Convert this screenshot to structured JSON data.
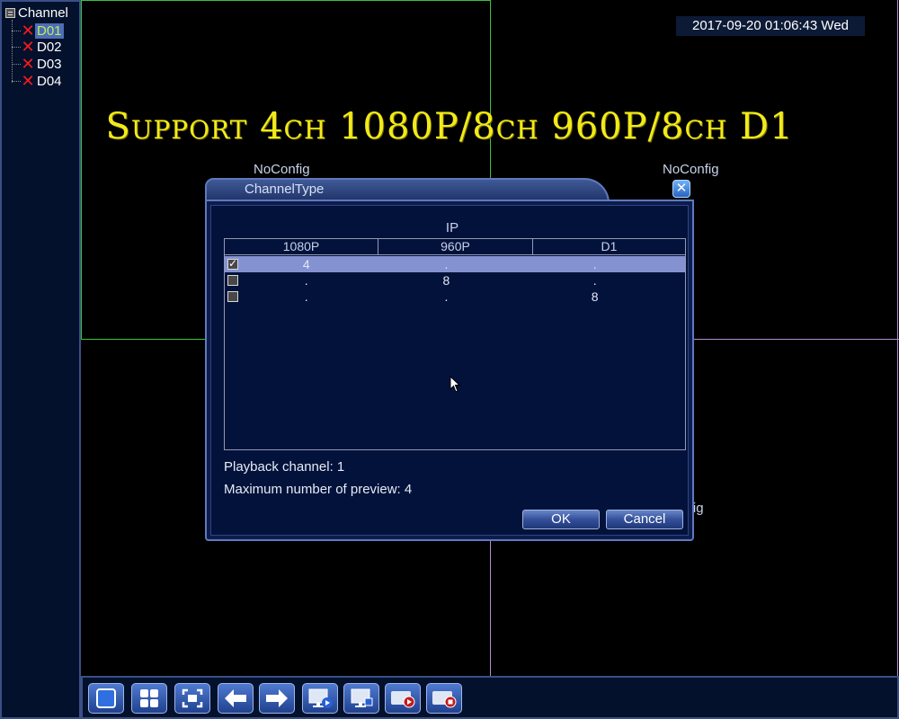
{
  "sidebar": {
    "root_label": "Channel",
    "channels": [
      {
        "label": "D01",
        "selected": true
      },
      {
        "label": "D02",
        "selected": false
      },
      {
        "label": "D03",
        "selected": false
      },
      {
        "label": "D04",
        "selected": false
      }
    ]
  },
  "status": {
    "datetime": "2017-09-20 01:06:43 Wed"
  },
  "banner": {
    "text": "Support 4ch 1080P/8ch 960P/8ch D1"
  },
  "tiles": {
    "tile2_label": "NoConfig",
    "tile3_label": "NoConfig",
    "tile4_label": "NoConfig"
  },
  "dialog": {
    "title": "ChannelType",
    "close_glyph": "✕",
    "group_label": "IP",
    "columns": [
      "1080P",
      "960P",
      "D1"
    ],
    "rows": [
      {
        "checked": true,
        "selected": true,
        "cells": [
          "4",
          ".",
          "."
        ]
      },
      {
        "checked": false,
        "selected": false,
        "cells": [
          ".",
          "8",
          "."
        ]
      },
      {
        "checked": false,
        "selected": false,
        "cells": [
          ".",
          ".",
          "8"
        ]
      }
    ],
    "playback_channel": "Playback channel: 1",
    "max_preview": "Maximum number of preview: 4",
    "ok_label": "OK",
    "cancel_label": "Cancel"
  },
  "toolbar": {
    "buttons": [
      "single-view",
      "quad-view",
      "fullscreen",
      "previous",
      "next",
      "playback",
      "display-settings",
      "record",
      "stop-record"
    ]
  },
  "colors": {
    "grid_green": "#3ec23e",
    "grid_magenta": "#b48cd2",
    "banner_yellow": "#f2ea19",
    "selected_row": "#8592d1"
  }
}
